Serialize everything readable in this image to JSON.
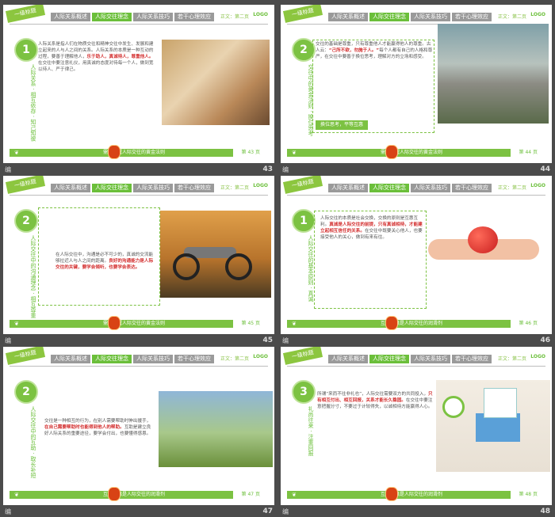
{
  "common": {
    "ribbon": "一级标题",
    "tabs": [
      "人际关系概述",
      "人际交往理念",
      "人际关系技巧",
      "若干心理效应"
    ],
    "page_info": "正文：第二页",
    "logo": "LOGO",
    "edit_label": "编"
  },
  "slides": [
    {
      "number": "43",
      "badge": "1",
      "vertical_title": "人际关系 · 相互依存 · 知己知彼",
      "body": "人际关系是指人们在物质交往和精神交往中发生、发展和建立起来的人与人之间的关系。人际关系的本质是一种互动的过程，要善于理解他人，",
      "body_hl": "乐于助人，真诚待人，尊重他人。",
      "body2": "在交往中要注意礼仪，用真诚的态度对待每一个人，做到宽以待人、严于律己。",
      "footer_bar": "需要掌握人际交往的黄金法则",
      "footer_page": "第 43 页"
    },
    {
      "number": "44",
      "badge": "2",
      "vertical_title": "交往中的黄金法则 · 换位思考",
      "body": "交往的基础是尊重，只有尊重他人才能赢得他人的尊重。古人云：",
      "body_hl": "“己所不欲，勿施于人。”",
      "body2": "每个人都有自己的人格和尊严，在交往中要善于换位思考，理解对方的立场和感受。",
      "tag": "换位思考，平等互惠",
      "footer_bar": "需要掌握人际交往的黄金法则",
      "footer_page": "第 44 页"
    },
    {
      "number": "45",
      "badge": "2",
      "vertical_title": "人际交往中的沟通理念 · 相互尊重",
      "body": "在人际交往中，沟通是必不可少的，真诚的交流能够拉近人与人之间的距离。",
      "body_hl": "良好的沟通能力是人际交往的关键，要学会倾听，也要学会表达。",
      "body2": "",
      "footer_bar": "需要掌握人际交往的黄金法则",
      "footer_page": "第 45 页"
    },
    {
      "number": "46",
      "badge": "1",
      "vertical_title": "人际交往的基本原则 · 真诚",
      "body": "人际交往的本质是社会交换，交换的原则是互惠互利。",
      "body_hl": "真诚是人际交往的前提，只有真诚相待，才能建立起相互信任的关系。",
      "body2": "在交往中既要关心他人，也要接受他人的关心，做到有来有往。",
      "footer_bar": "互利互惠是人际交往的润滑剂",
      "footer_page": "第 46 页"
    },
    {
      "number": "47",
      "badge": "2",
      "vertical_title": "人际交往中的互助 · 取长补短",
      "body": "交往是一种相互的行为，在别人需要帮助时伸出援手，",
      "body_hl": "在自己需要帮助时也能得到他人的帮助。",
      "body2": "互助是建立良好人际关系的重要途径，要学会付出，也要懂得感恩。",
      "footer_bar": "互利互惠是人际交往的润滑剂",
      "footer_page": "第 47 页"
    },
    {
      "number": "48",
      "badge": "3",
      "vertical_title": "礼尚往来 · 注重回报",
      "body": "所谓“来而不往非礼也”，人际交往需要双方的共同投入，",
      "body_hl": "只有相互付出、相互回报，关系才能长久稳固。",
      "body2": "在交往中要注意把握分寸，不要过于计较得失，以诚相待方能赢得人心。",
      "footer_bar": "互利互惠是人际交往的润滑剂",
      "footer_page": "第 48 页"
    }
  ]
}
